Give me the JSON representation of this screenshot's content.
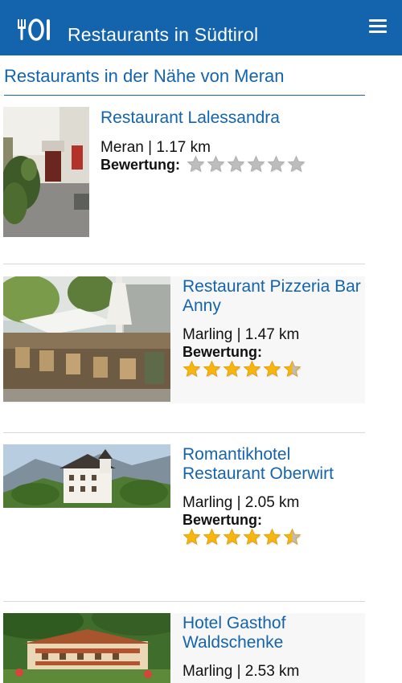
{
  "appbar": {
    "title": "Restaurants in Südtirol",
    "color": "#1464ad",
    "logo_icon": "cutlery-plate-icon",
    "menu_icon": "hamburger-menu-icon"
  },
  "section": {
    "title": "Restaurants in der Nähe von Meran"
  },
  "rating_label": "Bewertung:",
  "restaurants": [
    {
      "name": "Restaurant Lalessandra",
      "location": "Meran | 1.17 km",
      "rating": 0,
      "max_rating": 6
    },
    {
      "name": "Restaurant Pizzeria Bar Anny",
      "location": "Marling | 1.47 km",
      "rating": 5.5,
      "max_rating": 6
    },
    {
      "name": "Romantikhotel Restaurant Oberwirt",
      "location": "Marling | 2.05 km",
      "rating": 5.5,
      "max_rating": 6
    },
    {
      "name": "Hotel Gasthof Waldschenke",
      "location": "Marling | 2.53 km",
      "rating": null,
      "max_rating": 6
    }
  ]
}
